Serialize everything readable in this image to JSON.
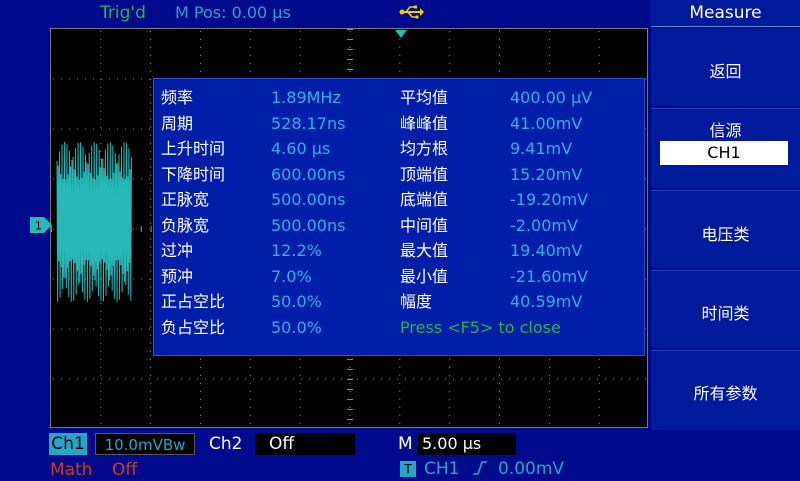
{
  "header": {
    "trigger_status": "Trig'd",
    "m_pos": "M Pos: 0.00 µs"
  },
  "measure_panel": {
    "left_rows": [
      {
        "label": "频率",
        "value": "1.89MHz"
      },
      {
        "label": "周期",
        "value": "528.17ns"
      },
      {
        "label": "上升时间",
        "value": "4.60 µs"
      },
      {
        "label": "下降时间",
        "value": "600.00ns"
      },
      {
        "label": "正脉宽",
        "value": "500.00ns"
      },
      {
        "label": "负脉宽",
        "value": "500.00ns"
      },
      {
        "label": "过冲",
        "value": "12.2%"
      },
      {
        "label": "预冲",
        "value": "7.0%"
      },
      {
        "label": "正占空比",
        "value": "50.0%"
      },
      {
        "label": "负占空比",
        "value": "50.0%"
      }
    ],
    "right_rows": [
      {
        "label": "平均值",
        "value": "400.00 µV"
      },
      {
        "label": "峰峰值",
        "value": "41.00mV"
      },
      {
        "label": "均方根",
        "value": "9.41mV"
      },
      {
        "label": "顶端值",
        "value": "15.20mV"
      },
      {
        "label": "底端值",
        "value": "-19.20mV"
      },
      {
        "label": "中间值",
        "value": "-2.00mV"
      },
      {
        "label": "最大值",
        "value": "19.40mV"
      },
      {
        "label": "最小值",
        "value": "-21.60mV"
      },
      {
        "label": "幅度",
        "value": "40.59mV"
      }
    ],
    "close_hint": "Press <F5> to close"
  },
  "menu": {
    "title": "Measure",
    "back": "返回",
    "source_label": "信源",
    "source_value": "CH1",
    "voltage": "电压类",
    "time": "时间类",
    "all_params": "所有参数"
  },
  "bottom": {
    "ch1_label": "Ch1",
    "ch1_value": "10.0mVBw",
    "ch2_label": "Ch2",
    "ch2_value": "Off",
    "math_label": "Math",
    "math_value": "Off",
    "timebase_label": "M",
    "timebase_value": "5.00 µs",
    "trigger_badge": "T",
    "trigger_source": "CH1",
    "trigger_level": "0.00mV",
    "channel_marker": "1"
  },
  "colors": {
    "background": "#000a8c",
    "trace": "#28b8b8",
    "green": "#2fb04a",
    "value": "#30b0e8",
    "math": "#d03a1a"
  },
  "icons": {
    "usb": "usb-icon",
    "trigger_edge": "rising-edge-icon",
    "channel_marker": "channel-1-marker-icon",
    "trigger_marker": "trigger-position-marker-icon"
  }
}
